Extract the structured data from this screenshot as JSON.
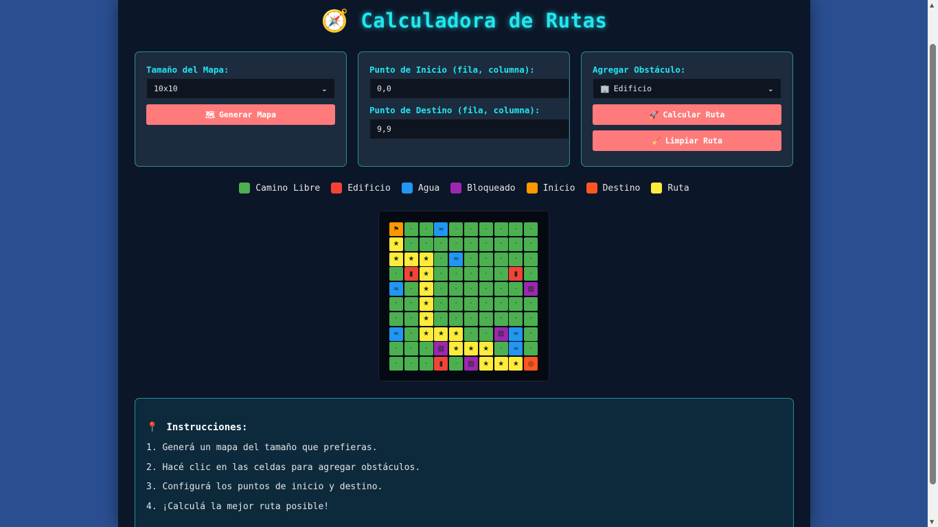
{
  "title": {
    "icon": "🧭",
    "text": "Calculadora de Rutas"
  },
  "panels": {
    "map_size": {
      "label": "Tamaño del Mapa:",
      "selected": "10x10",
      "button_icon": "🗺",
      "button_label": "Generar Mapa"
    },
    "points": {
      "start_label": "Punto de Inicio (fila, columna):",
      "start_value": "0,0",
      "end_label": "Punto de Destino (fila, columna):",
      "end_value": "9,9"
    },
    "obstacle": {
      "label": "Agregar Obstáculo:",
      "selected_icon": "🏢",
      "selected": "Edificio",
      "calc_icon": "🚀",
      "calc_label": "Calcular Ruta",
      "clear_icon": "🧹",
      "clear_label": "Limpiar Ruta"
    }
  },
  "legend": [
    {
      "label": "Camino Libre",
      "color": "#4caf50"
    },
    {
      "label": "Edificio",
      "color": "#f44336"
    },
    {
      "label": "Agua",
      "color": "#2196f3"
    },
    {
      "label": "Bloqueado",
      "color": "#9c27b0"
    },
    {
      "label": "Inicio",
      "color": "#ff9800"
    },
    {
      "label": "Destino",
      "color": "#ff5722"
    },
    {
      "label": "Ruta",
      "color": "#ffeb3b"
    }
  ],
  "cell_types": {
    "F": {
      "color": "#4caf50",
      "glyph": "·"
    },
    "B": {
      "color": "#f44336",
      "glyph": "▮"
    },
    "W": {
      "color": "#2196f3",
      "glyph": "≈"
    },
    "X": {
      "color": "#9c27b0",
      "glyph": "▨"
    },
    "S": {
      "color": "#ff9800",
      "glyph": "⚑"
    },
    "E": {
      "color": "#ff5722",
      "glyph": "◎"
    },
    "R": {
      "color": "#ffeb3b",
      "glyph": "★"
    }
  },
  "grid": [
    [
      "S",
      "F",
      "F",
      "W",
      "F",
      "F",
      "F",
      "F",
      "F",
      "F"
    ],
    [
      "R",
      "F",
      "F",
      "F",
      "F",
      "F",
      "F",
      "F",
      "F",
      "F"
    ],
    [
      "R",
      "R",
      "R",
      "F",
      "W",
      "F",
      "F",
      "F",
      "F",
      "F"
    ],
    [
      "F",
      "B",
      "R",
      "F",
      "F",
      "F",
      "F",
      "F",
      "B",
      "F"
    ],
    [
      "W",
      "F",
      "R",
      "F",
      "F",
      "F",
      "F",
      "F",
      "F",
      "X"
    ],
    [
      "F",
      "F",
      "R",
      "F",
      "F",
      "F",
      "F",
      "F",
      "F",
      "F"
    ],
    [
      "F",
      "F",
      "R",
      "F",
      "F",
      "F",
      "F",
      "F",
      "F",
      "F"
    ],
    [
      "W",
      "F",
      "R",
      "R",
      "R",
      "F",
      "F",
      "X",
      "W",
      "F"
    ],
    [
      "F",
      "F",
      "F",
      "X",
      "R",
      "R",
      "R",
      "F",
      "W",
      "F"
    ],
    [
      "F",
      "F",
      "F",
      "B",
      "F",
      "X",
      "R",
      "R",
      "R",
      "E"
    ]
  ],
  "instructions": {
    "icon": "📍",
    "heading": "Instrucciones:",
    "steps": [
      "1. Generá un mapa del tamaño que prefieras.",
      "2. Hacé clic en las celdas para agregar obstáculos.",
      "3. Configurá los puntos de inicio y destino.",
      "4. ¡Calculá la mejor ruta posible!"
    ]
  }
}
